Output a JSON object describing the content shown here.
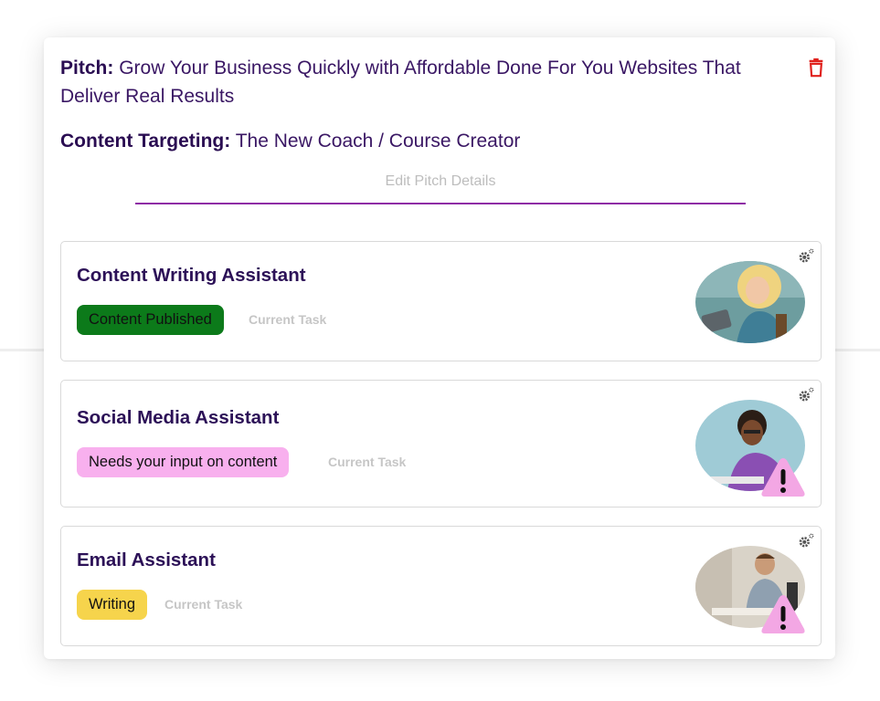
{
  "pitch": {
    "label": "Pitch:",
    "text": "Grow Your Business Quickly with Affordable Done For You Websites That Deliver Real Results"
  },
  "targeting": {
    "label": "Content Targeting:",
    "text": "The New Coach / Course Creator"
  },
  "edit_link": "Edit Pitch Details",
  "colors": {
    "title": "#2c1157",
    "underline": "#8e2aa5",
    "trash": "#e0201c"
  },
  "assistants": [
    {
      "name": "Content Writing Assistant",
      "status": "Content Published",
      "status_color": "#0c7a1a",
      "task_label": "Current Task",
      "icon": "gear-icon",
      "warning": false
    },
    {
      "name": "Social Media Assistant",
      "status": "Needs your input on content",
      "status_color": "#f8b0ee",
      "task_label": "Current Task",
      "icon": "gear-icon",
      "warning": true
    },
    {
      "name": "Email Assistant",
      "status": "Writing",
      "status_color": "#f6d44c",
      "task_label": "Current Task",
      "icon": "gear-icon",
      "warning": true
    }
  ]
}
